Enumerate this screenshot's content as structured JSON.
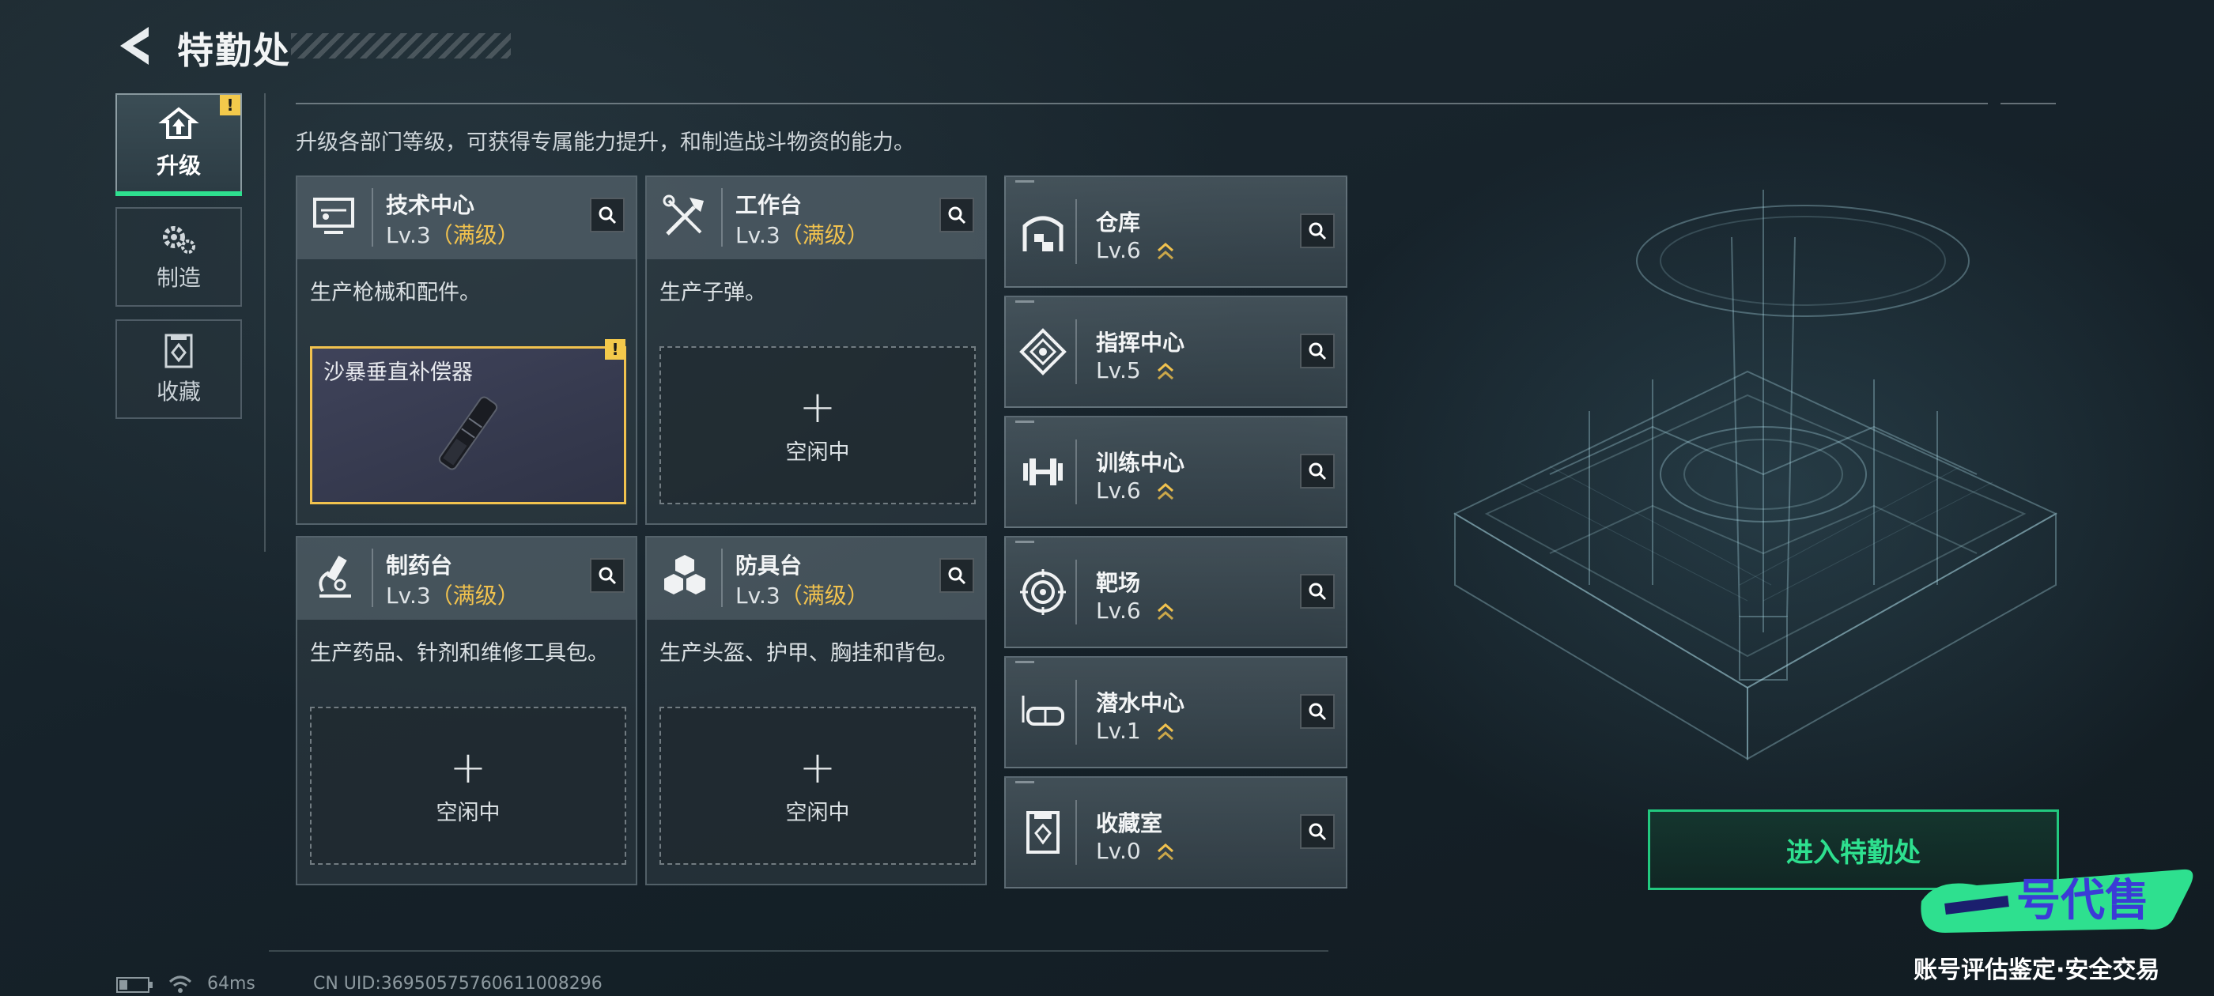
{
  "header": {
    "title": "特勤处"
  },
  "nav": {
    "items": [
      {
        "label": "升级",
        "icon": "upgrade-icon",
        "active": true,
        "badge": "!"
      },
      {
        "label": "制造",
        "icon": "gear-icon"
      },
      {
        "label": "收藏",
        "icon": "collection-icon"
      }
    ]
  },
  "description": "升级各部门等级，可获得专属能力提升，和制造战斗物资的能力。",
  "departments": [
    {
      "name": "技术中心",
      "level": "Lv.3",
      "max": "（满级）",
      "desc": "生产枪械和配件。",
      "slot_item": "沙暴垂直补偿器",
      "badge": "!"
    },
    {
      "name": "工作台",
      "level": "Lv.3",
      "max": "（满级）",
      "desc": "生产子弹。",
      "slot_plus": "+",
      "slot_status": "空闲中"
    },
    {
      "name": "制药台",
      "level": "Lv.3",
      "max": "（满级）",
      "desc": "生产药品、针剂和维修工具包。",
      "slot_plus": "+",
      "slot_status": "空闲中"
    },
    {
      "name": "防具台",
      "level": "Lv.3",
      "max": "（满级）",
      "desc": "生产头盔、护甲、胸挂和背包。",
      "slot_plus": "+",
      "slot_status": "空闲中"
    }
  ],
  "facilities": [
    {
      "name": "仓库",
      "level": "Lv.6",
      "icon": "warehouse-icon"
    },
    {
      "name": "指挥中心",
      "level": "Lv.5",
      "icon": "command-center-icon"
    },
    {
      "name": "训练中心",
      "level": "Lv.6",
      "icon": "dumbbell-icon"
    },
    {
      "name": "靶场",
      "level": "Lv.6",
      "icon": "target-icon"
    },
    {
      "name": "潜水中心",
      "level": "Lv.1",
      "icon": "diving-mask-icon"
    },
    {
      "name": "收藏室",
      "level": "Lv.0",
      "icon": "collection-room-icon"
    }
  ],
  "enter_button": "进入特勤处",
  "status": {
    "ping": "64ms",
    "uid": "CN UID:3695057576061100829​6"
  },
  "watermark": {
    "logo": "一号代售",
    "tagline": "账号评估鉴定·安全交易"
  },
  "colors": {
    "accent_green": "#2ee08f",
    "max_level_gold": "#f1c24e",
    "warning": "#f3c94b"
  }
}
